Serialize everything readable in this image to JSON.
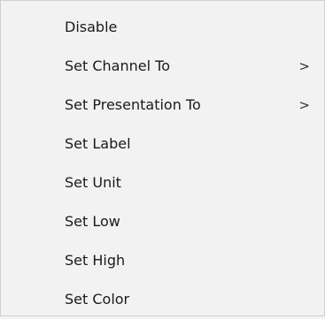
{
  "menu": {
    "items": [
      {
        "label": "Disable",
        "submenu": false
      },
      {
        "label": "Set Channel To",
        "submenu": true
      },
      {
        "label": "Set Presentation To",
        "submenu": true
      },
      {
        "label": "Set Label",
        "submenu": false
      },
      {
        "label": "Set Unit",
        "submenu": false
      },
      {
        "label": "Set Low",
        "submenu": false
      },
      {
        "label": "Set High",
        "submenu": false
      },
      {
        "label": "Set Color",
        "submenu": false
      }
    ],
    "submenu_glyph": ">"
  }
}
